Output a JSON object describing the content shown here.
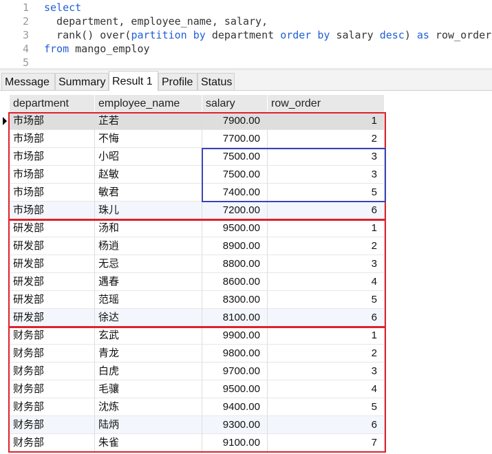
{
  "editor": {
    "lines": [
      {
        "num": "1",
        "segments": [
          {
            "t": "select",
            "k": true
          }
        ]
      },
      {
        "num": "2",
        "segments": [
          {
            "t": "  department, employee_name, salary,",
            "k": false
          }
        ]
      },
      {
        "num": "3",
        "segments": [
          {
            "t": "  rank() over(",
            "k": false
          },
          {
            "t": "partition by",
            "k": true
          },
          {
            "t": " department ",
            "k": false
          },
          {
            "t": "order by",
            "k": true
          },
          {
            "t": " salary ",
            "k": false
          },
          {
            "t": "desc",
            "k": true
          },
          {
            "t": ") ",
            "k": false
          },
          {
            "t": "as",
            "k": true
          },
          {
            "t": " row_order",
            "k": false
          }
        ]
      },
      {
        "num": "4",
        "segments": [
          {
            "t": "from",
            "k": true
          },
          {
            "t": " mango_employ",
            "k": false
          }
        ]
      },
      {
        "num": "5",
        "segments": []
      }
    ]
  },
  "tabs": [
    {
      "label": "Message",
      "active": false
    },
    {
      "label": "Summary",
      "active": false
    },
    {
      "label": "Result 1",
      "active": true
    },
    {
      "label": "Profile",
      "active": false
    },
    {
      "label": "Status",
      "active": false
    }
  ],
  "table": {
    "columns": [
      "department",
      "employee_name",
      "salary",
      "row_order"
    ],
    "rows": [
      [
        "市场部",
        "芷若",
        "7900.00",
        "1"
      ],
      [
        "市场部",
        "不悔",
        "7700.00",
        "2"
      ],
      [
        "市场部",
        "小昭",
        "7500.00",
        "3"
      ],
      [
        "市场部",
        "赵敏",
        "7500.00",
        "3"
      ],
      [
        "市场部",
        "敏君",
        "7400.00",
        "5"
      ],
      [
        "市场部",
        "珠儿",
        "7200.00",
        "6"
      ],
      [
        "研发部",
        "汤和",
        "9500.00",
        "1"
      ],
      [
        "研发部",
        "杨逍",
        "8900.00",
        "2"
      ],
      [
        "研发部",
        "无忌",
        "8800.00",
        "3"
      ],
      [
        "研发部",
        "遇春",
        "8600.00",
        "4"
      ],
      [
        "研发部",
        "范瑶",
        "8300.00",
        "5"
      ],
      [
        "研发部",
        "徐达",
        "8100.00",
        "6"
      ],
      [
        "财务部",
        "玄武",
        "9900.00",
        "1"
      ],
      [
        "财务部",
        "青龙",
        "9800.00",
        "2"
      ],
      [
        "财务部",
        "白虎",
        "9700.00",
        "3"
      ],
      [
        "财务部",
        "毛骧",
        "9500.00",
        "4"
      ],
      [
        "财务部",
        "沈炼",
        "9400.00",
        "5"
      ],
      [
        "财务部",
        "陆炳",
        "9300.00",
        "6"
      ],
      [
        "财务部",
        "朱雀",
        "9100.00",
        "7"
      ]
    ],
    "selected_row": 0
  },
  "colors": {
    "keyword": "#1f5fd6",
    "partition_box": "#e0202a",
    "tie_box": "#3a43b8"
  }
}
